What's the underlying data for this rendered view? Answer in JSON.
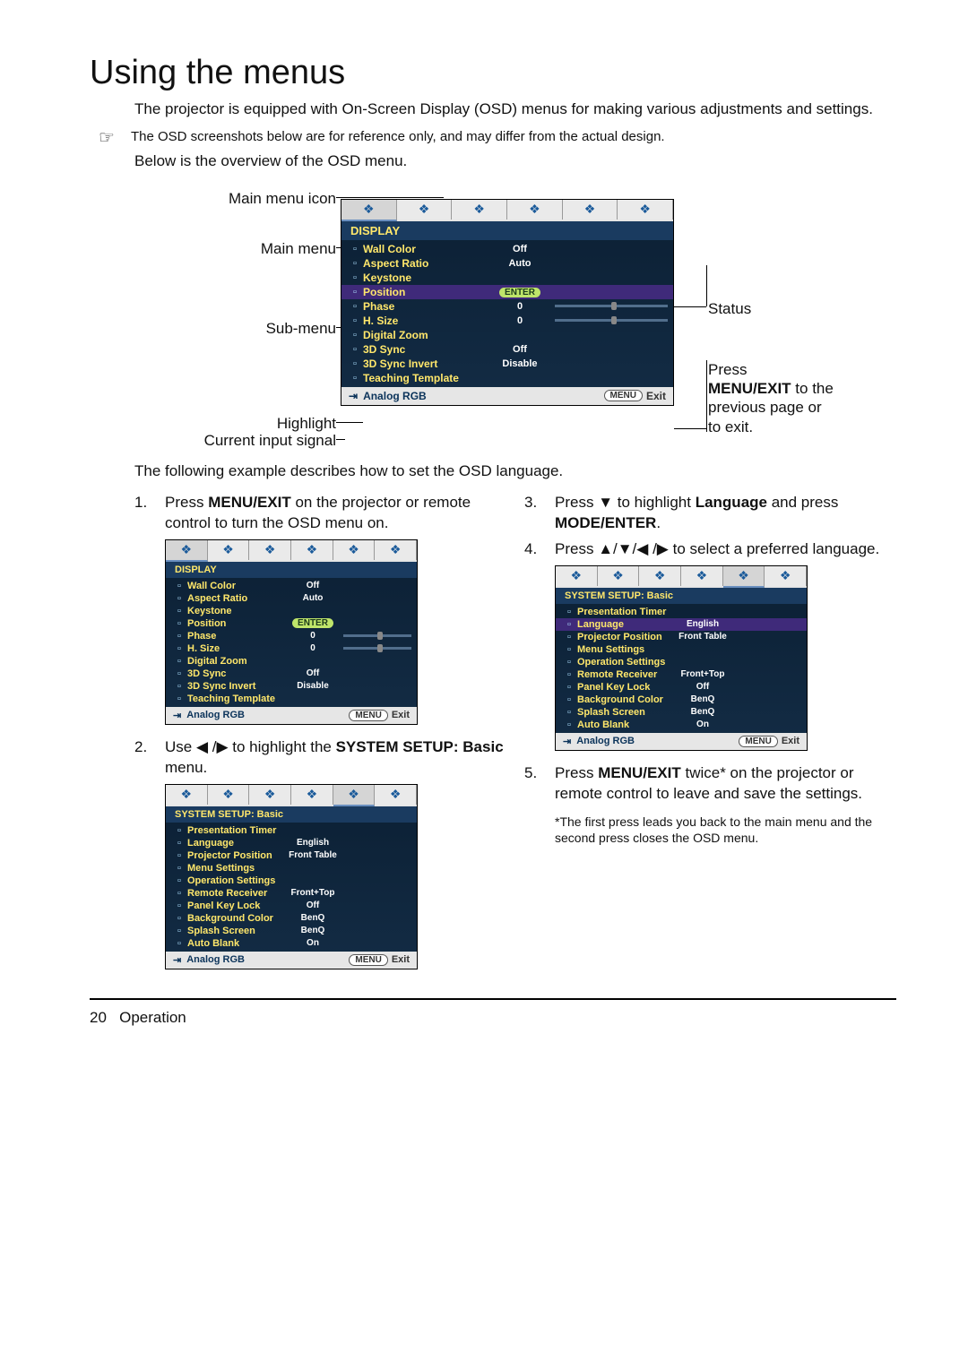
{
  "heading": "Using the menus",
  "intro": "The projector is equipped with On-Screen Display (OSD) menus for making various adjustments and settings.",
  "note_text": "The OSD screenshots below are for reference only, and may differ from the actual design.",
  "after_note": "Below is the overview of the OSD menu.",
  "annotations": {
    "main_menu_icon": "Main menu icon",
    "main_menu": "Main menu",
    "sub_menu": "Sub-menu",
    "highlight": "Highlight",
    "current_input_signal": "Current input signal",
    "status": "Status",
    "press_menu_exit": "Press MENU/EXIT to the previous page or to exit.",
    "press_menu_exit_bold1": "MENU/",
    "press_menu_exit_bold2": "EXIT"
  },
  "osd_display": {
    "title": "DISPLAY",
    "rows": [
      {
        "name": "Wall Color",
        "val": "Off"
      },
      {
        "name": "Aspect Ratio",
        "val": "Auto"
      },
      {
        "name": "Keystone",
        "val": ""
      },
      {
        "name": "Position",
        "val": "",
        "enter": true
      },
      {
        "name": "Phase",
        "val": "0",
        "bar": true
      },
      {
        "name": "H. Size",
        "val": "0",
        "bar": true
      },
      {
        "name": "Digital Zoom",
        "val": ""
      },
      {
        "name": "3D Sync",
        "val": "Off"
      },
      {
        "name": "3D Sync Invert",
        "val": "Disable"
      },
      {
        "name": "Teaching Template",
        "val": ""
      }
    ],
    "footer_signal": "Analog RGB",
    "footer_menu": "MENU",
    "footer_exit": "Exit"
  },
  "followup": "The following example describes how to set the OSD language.",
  "steps": {
    "s1": {
      "num": "1.",
      "text": "Press MENU/EXIT on the projector or remote control to turn the OSD menu on.",
      "bold": "MENU/EXIT"
    },
    "s2": {
      "num": "2.",
      "text_a": "Use ",
      "text_b": " to highlight the ",
      "bold": "SYSTEM SETUP: Basic",
      "text_c": " menu."
    },
    "s3": {
      "num": "3.",
      "text_a": "Press ",
      "text_b": " to highlight ",
      "bold1": "Language",
      "text_c": " and press ",
      "bold2": "MODE/ENTER",
      "text_d": "."
    },
    "s4": {
      "num": "4.",
      "text_a": "Press ",
      "text_b": " to select a preferred language."
    },
    "s5": {
      "num": "5.",
      "text_a": "Press ",
      "bold": "MENU/EXIT",
      "text_b": " twice* on the projector or remote control to leave and save the settings."
    },
    "s5_note": "*The first press leads you back to the main menu and the second press closes the OSD menu."
  },
  "osd_system": {
    "title": "SYSTEM SETUP: Basic",
    "rows": [
      {
        "name": "Presentation Timer",
        "val": ""
      },
      {
        "name": "Language",
        "val": "English"
      },
      {
        "name": "Projector Position",
        "val": "Front Table"
      },
      {
        "name": "Menu Settings",
        "val": ""
      },
      {
        "name": "Operation Settings",
        "val": ""
      },
      {
        "name": "Remote Receiver",
        "val": "Front+Top"
      },
      {
        "name": "Panel Key Lock",
        "val": "Off"
      },
      {
        "name": "Background Color",
        "val": "BenQ"
      },
      {
        "name": "Splash Screen",
        "val": "BenQ"
      },
      {
        "name": "Auto Blank",
        "val": "On"
      }
    ],
    "footer_signal": "Analog RGB",
    "footer_menu": "MENU",
    "footer_exit": "Exit"
  },
  "page_number": "20",
  "page_section": "Operation",
  "icons": {
    "tab_glyphs": [
      "❖",
      "❖",
      "❖",
      "❖",
      "❖",
      "❖"
    ],
    "note_glyph": "☞",
    "row_glyph": "▫",
    "input_glyph": "⇥"
  }
}
